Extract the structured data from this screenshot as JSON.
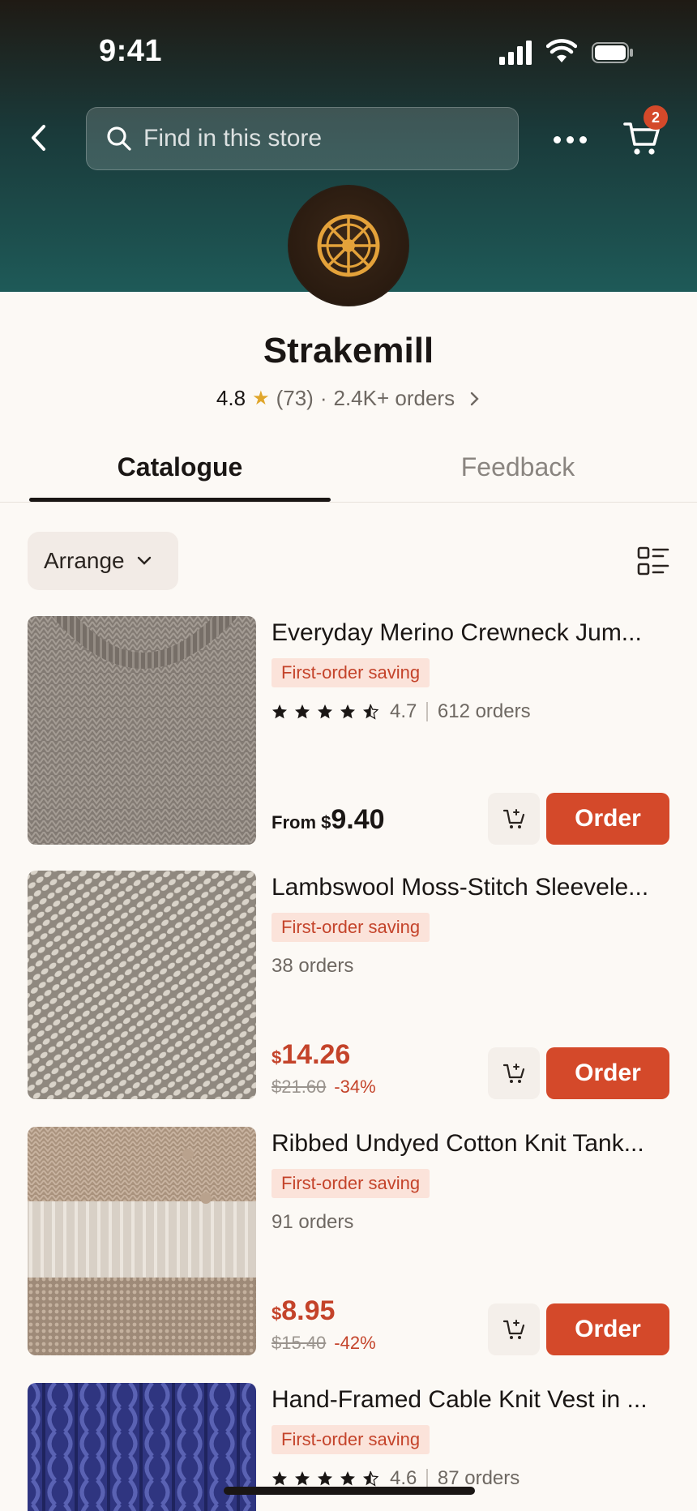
{
  "status_bar": {
    "time": "9:41"
  },
  "header": {
    "search_placeholder": "Find in this store",
    "cart_count": "2"
  },
  "store": {
    "name": "Strakemill",
    "rating": "4.8",
    "reviews": "(73)",
    "dot": "·",
    "orders": "2.4K+ orders"
  },
  "tabs": [
    {
      "label": "Catalogue",
      "active": true
    },
    {
      "label": "Feedback",
      "active": false
    }
  ],
  "toolbar": {
    "arrange_label": "Arrange"
  },
  "products": [
    {
      "title": "Everyday Merino Crewneck Jum...",
      "tag": "First-order saving",
      "rating": "4.7",
      "orders": "612 orders",
      "price_prefix": "From ",
      "currency": "$",
      "price": "9.40",
      "order_label": "Order",
      "stars": 4.5
    },
    {
      "title": "Lambswool Moss-Stitch Sleevele...",
      "tag": "First-order saving",
      "orders": "38 orders",
      "currency": "$",
      "price": "14.26",
      "old_price": "$21.60",
      "discount": "-34%",
      "order_label": "Order"
    },
    {
      "title": "Ribbed Undyed Cotton Knit Tank...",
      "tag": "First-order saving",
      "orders": "91 orders",
      "currency": "$",
      "price": "8.95",
      "old_price": "$15.40",
      "discount": "-42%",
      "order_label": "Order"
    },
    {
      "title": "Hand-Framed Cable Knit Vest in ...",
      "tag": "First-order saving",
      "rating": "4.6",
      "orders": "87 orders",
      "stars": 4.5
    }
  ],
  "colors": {
    "accent": "#d4492a",
    "tag_bg": "#fbe3da",
    "star": "#e0a62b",
    "header_gradient_top": "#1f1a14",
    "header_gradient_bottom": "#1e5a58"
  }
}
